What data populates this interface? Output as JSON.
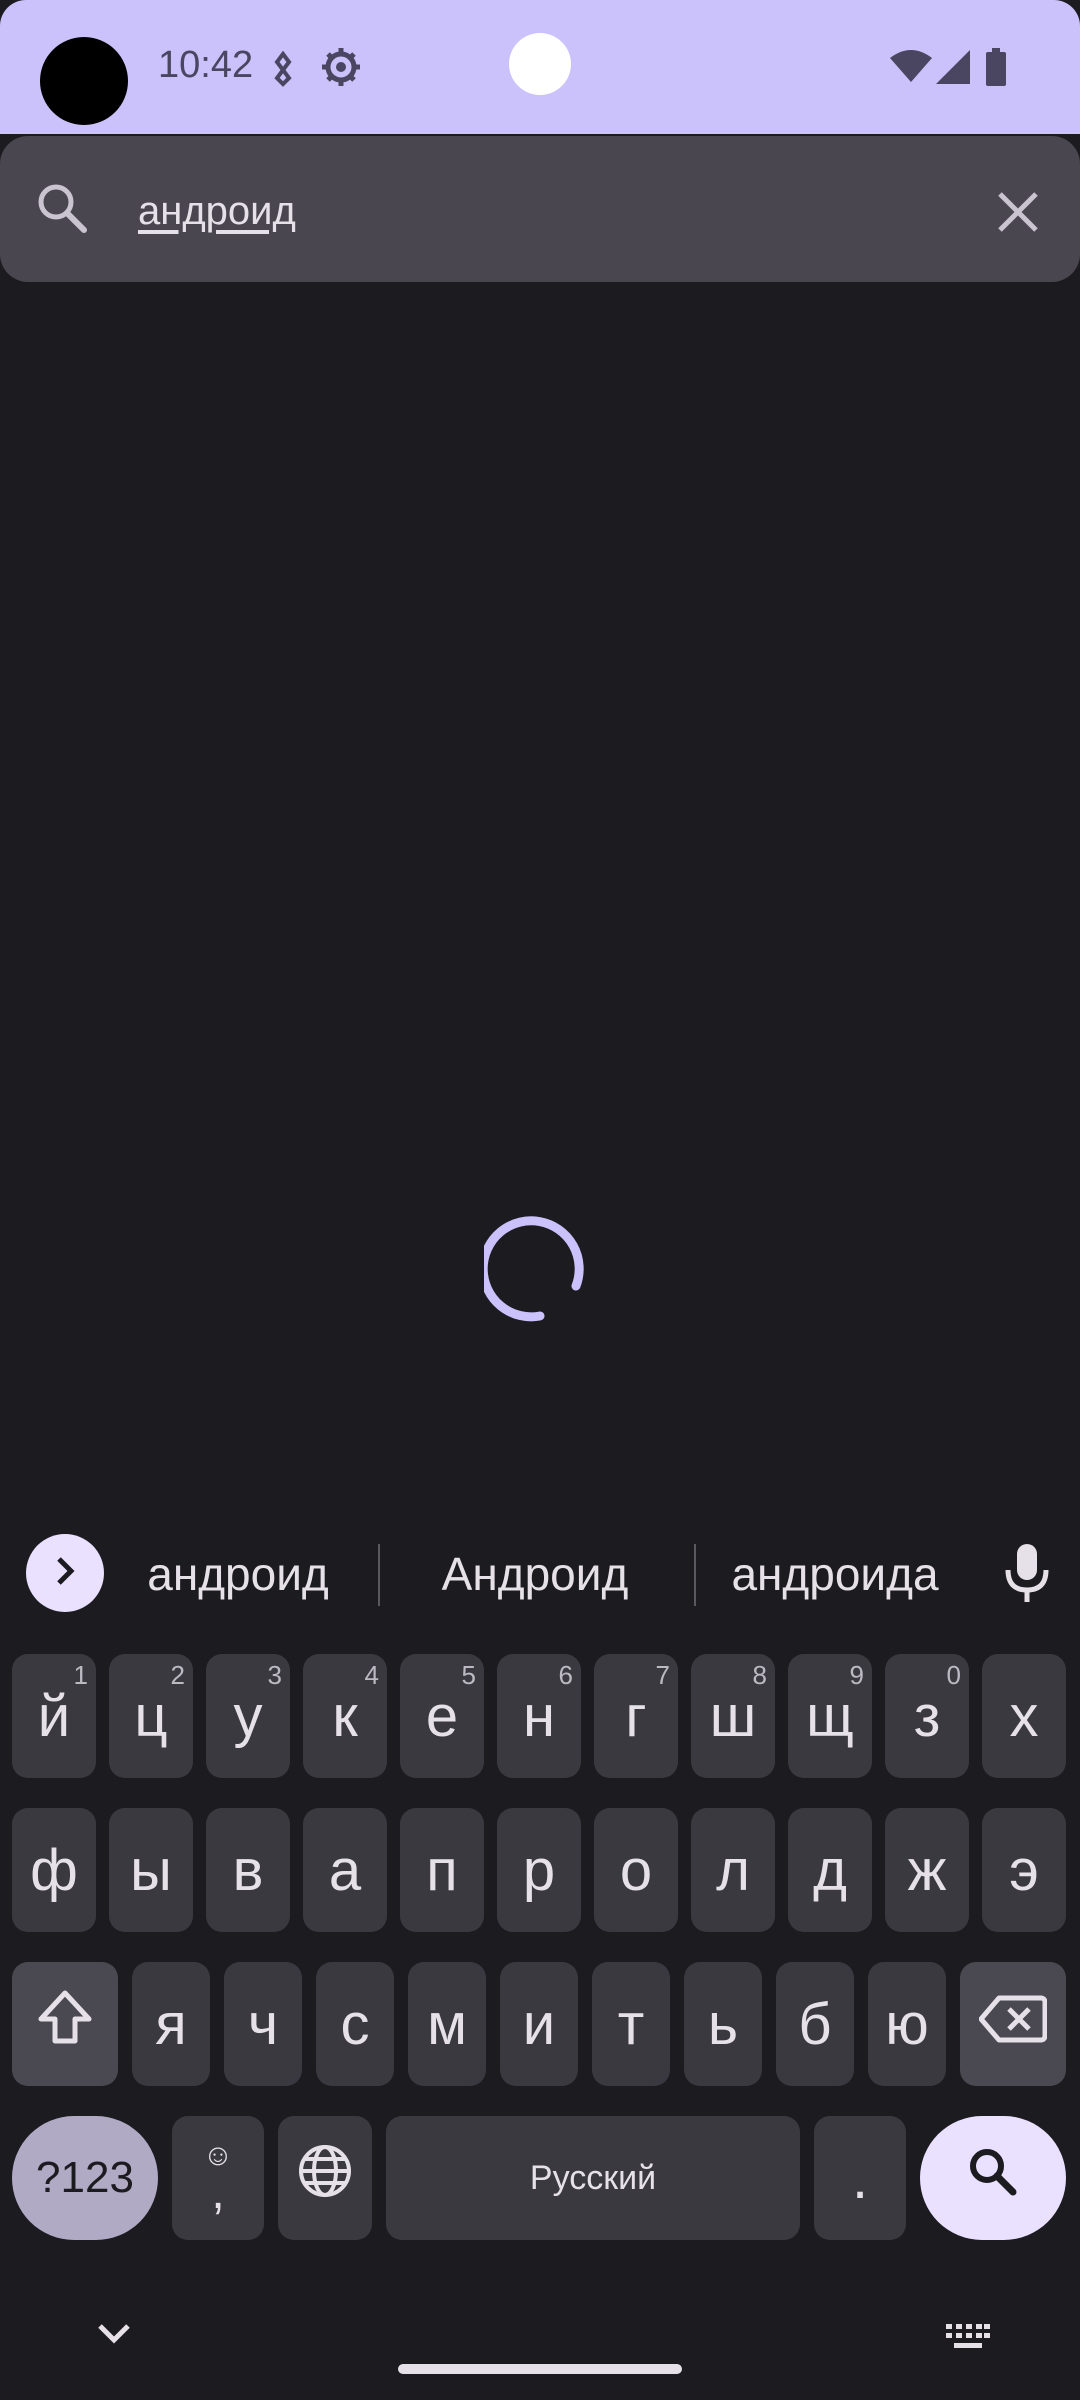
{
  "status_bar": {
    "time": "10:42",
    "icons": [
      "debug-icon",
      "settings-sync-icon",
      "wifi-icon",
      "signal-icon",
      "battery-icon"
    ],
    "background": "#cbc2fb"
  },
  "search": {
    "query": "андроид",
    "icon": "search-icon",
    "clear_icon": "close-icon"
  },
  "loading": {
    "indicator": "spinner",
    "color": "#cbc2fb"
  },
  "keyboard": {
    "suggestions": [
      "андроид",
      "Андроид",
      "андроида"
    ],
    "row1": [
      {
        "label": "й",
        "hint": "1"
      },
      {
        "label": "ц",
        "hint": "2"
      },
      {
        "label": "у",
        "hint": "3"
      },
      {
        "label": "к",
        "hint": "4"
      },
      {
        "label": "е",
        "hint": "5"
      },
      {
        "label": "н",
        "hint": "6"
      },
      {
        "label": "г",
        "hint": "7"
      },
      {
        "label": "ш",
        "hint": "8"
      },
      {
        "label": "щ",
        "hint": "9"
      },
      {
        "label": "з",
        "hint": "0"
      },
      {
        "label": "х",
        "hint": ""
      }
    ],
    "row2": [
      "ф",
      "ы",
      "в",
      "а",
      "п",
      "р",
      "о",
      "л",
      "д",
      "ж",
      "э"
    ],
    "row3": [
      "я",
      "ч",
      "с",
      "м",
      "и",
      "т",
      "ь",
      "б",
      "ю"
    ],
    "symbols_label": "?123",
    "comma_label": ",",
    "space_label": "Русский",
    "period_label": ".",
    "accent_color": "#e9e1ff"
  }
}
